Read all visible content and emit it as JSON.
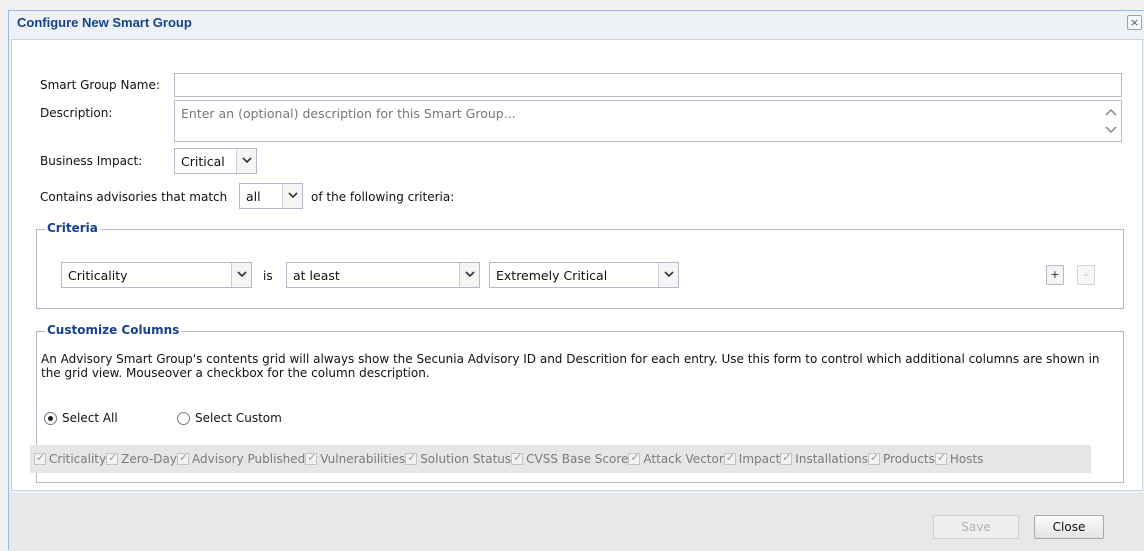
{
  "dialog": {
    "title": "Configure New Smart Group",
    "close_glyph": "×"
  },
  "form": {
    "name_label": "Smart Group Name:",
    "name_value": "",
    "description_label": "Description:",
    "description_placeholder": "Enter an (optional) description for this Smart Group...",
    "business_impact_label": "Business Impact:",
    "business_impact_value": "Critical",
    "match_prefix": "Contains advisories that match",
    "match_value": "all",
    "match_suffix": "of the following criteria:"
  },
  "criteria": {
    "legend": "Criteria",
    "field_value": "Criticality",
    "is_text": "is",
    "operator_value": "at least",
    "level_value": "Extremely Critical",
    "add_label": "+",
    "remove_label": "-"
  },
  "columns": {
    "legend": "Customize Columns",
    "description": "An Advisory Smart Group's contents grid will always show the Secunia Advisory ID and Descrition for each entry. Use this form to control which additional columns are shown in the grid view. Mouseover a checkbox for the column description.",
    "select_all_label": "Select All",
    "select_custom_label": "Select Custom",
    "selected_option": "Select All",
    "items": [
      {
        "label": "Criticality",
        "checked": true
      },
      {
        "label": "Zero-Day",
        "checked": true
      },
      {
        "label": "Advisory Published",
        "checked": true
      },
      {
        "label": "Vulnerabilities",
        "checked": true
      },
      {
        "label": "Solution Status",
        "checked": true
      },
      {
        "label": "CVSS Base Score",
        "checked": true
      },
      {
        "label": "Attack Vector",
        "checked": true
      },
      {
        "label": "Impact",
        "checked": true
      },
      {
        "label": "Installations",
        "checked": true
      },
      {
        "label": "Products",
        "checked": true
      },
      {
        "label": "Hosts",
        "checked": true
      }
    ]
  },
  "footer": {
    "save_label": "Save",
    "close_label": "Close"
  },
  "icons": {
    "dropdown": "chevron-down-icon",
    "scroll_up": "chevron-up-icon",
    "scroll_down": "chevron-down-icon",
    "close": "close-icon"
  },
  "colors": {
    "title": "#15428b",
    "border": "#99bbe8"
  }
}
